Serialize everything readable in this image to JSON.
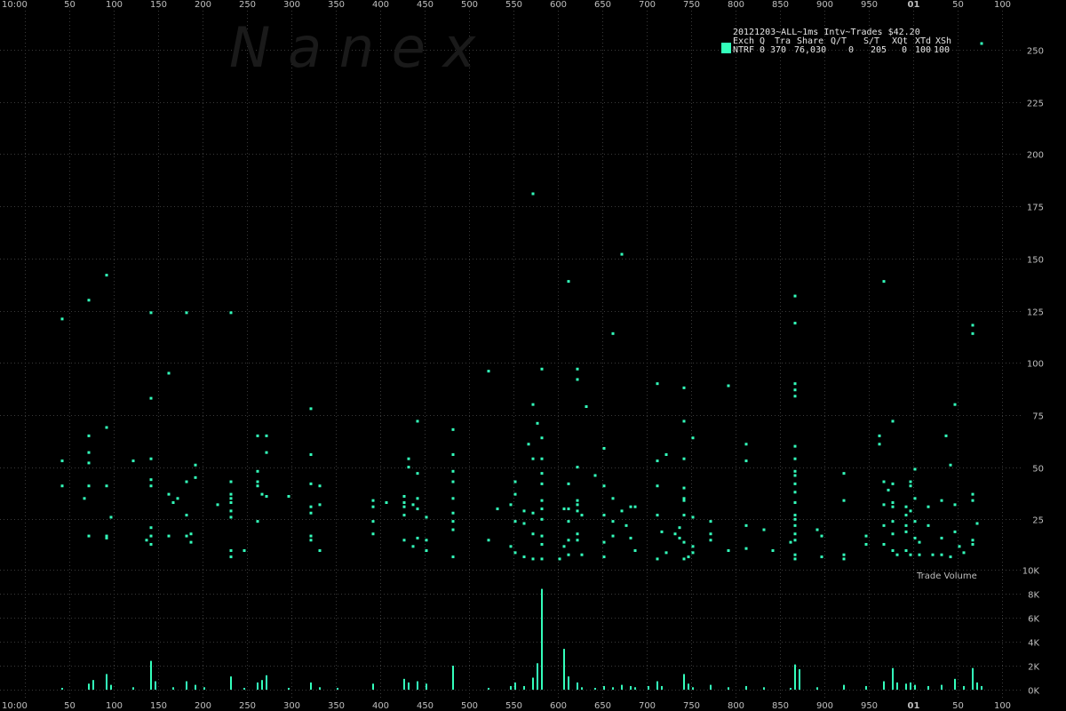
{
  "chart_data": [
    {
      "type": "scatter",
      "title": "20121203~ALL~1ms Intv~Trades $42.20",
      "watermark": "Nanex",
      "legend": {
        "placement": "top-right",
        "header": [
          "Exch",
          "Q",
          "Tra",
          "Share",
          "Q/T",
          "S/T",
          "XQt",
          "XTd",
          "XSh"
        ],
        "rows": [
          {
            "name": "NTRF",
            "values": [
              "0",
              "370",
              "76,030",
              "0",
              "205",
              "0",
              "100",
              "100"
            ],
            "color": "#33ffbb"
          }
        ]
      },
      "x_ticks": [
        "10:00",
        "50",
        "100",
        "150",
        "200",
        "250",
        "300",
        "350",
        "400",
        "450",
        "500",
        "550",
        "600",
        "650",
        "700",
        "750",
        "800",
        "850",
        "900",
        "950",
        "01",
        "50",
        "100"
      ],
      "xlim": [
        0,
        1100
      ],
      "y_ticks": [
        "25",
        "50",
        "75",
        "100",
        "125",
        "150",
        "175",
        "200",
        "225",
        "250"
      ],
      "ylim": [
        0,
        260
      ],
      "grid": true,
      "color": "#33ffbb",
      "points": [
        [
          42,
          121
        ],
        [
          42,
          53
        ],
        [
          42,
          41
        ],
        [
          72,
          130
        ],
        [
          92,
          142
        ],
        [
          72,
          65
        ],
        [
          72,
          57
        ],
        [
          72,
          52
        ],
        [
          72,
          41
        ],
        [
          92,
          69
        ],
        [
          92,
          41
        ],
        [
          67,
          35
        ],
        [
          97,
          26
        ],
        [
          72,
          17
        ],
        [
          92,
          17
        ],
        [
          92,
          16
        ],
        [
          142,
          124
        ],
        [
          182,
          124
        ],
        [
          232,
          124
        ],
        [
          142,
          83
        ],
        [
          162,
          95
        ],
        [
          122,
          53
        ],
        [
          142,
          54
        ],
        [
          142,
          44
        ],
        [
          142,
          41
        ],
        [
          137,
          15
        ],
        [
          142,
          21
        ],
        [
          142,
          17
        ],
        [
          142,
          13
        ],
        [
          162,
          17
        ],
        [
          182,
          17
        ],
        [
          182,
          27
        ],
        [
          182,
          43
        ],
        [
          187,
          18
        ],
        [
          187,
          14
        ],
        [
          192,
          51
        ],
        [
          192,
          45
        ],
        [
          162,
          37
        ],
        [
          167,
          33
        ],
        [
          172,
          35
        ],
        [
          217,
          32
        ],
        [
          232,
          43
        ],
        [
          232,
          37
        ],
        [
          232,
          35
        ],
        [
          232,
          33
        ],
        [
          232,
          29
        ],
        [
          232,
          26
        ],
        [
          232,
          10
        ],
        [
          232,
          7
        ],
        [
          247,
          10
        ],
        [
          262,
          65
        ],
        [
          262,
          48
        ],
        [
          262,
          43
        ],
        [
          262,
          41
        ],
        [
          262,
          24
        ],
        [
          267,
          37
        ],
        [
          272,
          65
        ],
        [
          272,
          57
        ],
        [
          272,
          36
        ],
        [
          297,
          36
        ],
        [
          322,
          78
        ],
        [
          322,
          56
        ],
        [
          322,
          42
        ],
        [
          322,
          31
        ],
        [
          322,
          28
        ],
        [
          322,
          17
        ],
        [
          322,
          15
        ],
        [
          332,
          41
        ],
        [
          332,
          32
        ],
        [
          332,
          10
        ],
        [
          392,
          34
        ],
        [
          392,
          31
        ],
        [
          392,
          24
        ],
        [
          392,
          18
        ],
        [
          407,
          33
        ],
        [
          427,
          36
        ],
        [
          427,
          33
        ],
        [
          427,
          31
        ],
        [
          427,
          27
        ],
        [
          427,
          15
        ],
        [
          432,
          54
        ],
        [
          432,
          50
        ],
        [
          437,
          32
        ],
        [
          437,
          12
        ],
        [
          442,
          72
        ],
        [
          442,
          47
        ],
        [
          442,
          35
        ],
        [
          442,
          30
        ],
        [
          442,
          16
        ],
        [
          452,
          26
        ],
        [
          452,
          15
        ],
        [
          452,
          10
        ],
        [
          482,
          68
        ],
        [
          482,
          56
        ],
        [
          482,
          48
        ],
        [
          482,
          43
        ],
        [
          482,
          35
        ],
        [
          482,
          28
        ],
        [
          482,
          24
        ],
        [
          482,
          20
        ],
        [
          482,
          7
        ],
        [
          522,
          96
        ],
        [
          522,
          15
        ],
        [
          532,
          30
        ],
        [
          547,
          32
        ],
        [
          547,
          12
        ],
        [
          552,
          43
        ],
        [
          552,
          37
        ],
        [
          552,
          24
        ],
        [
          552,
          9
        ],
        [
          562,
          29
        ],
        [
          562,
          23
        ],
        [
          562,
          7
        ],
        [
          572,
          80
        ],
        [
          567,
          61
        ],
        [
          572,
          54
        ],
        [
          572,
          28
        ],
        [
          572,
          18
        ],
        [
          577,
          71
        ],
        [
          582,
          97
        ],
        [
          582,
          64
        ],
        [
          582,
          54
        ],
        [
          582,
          47
        ],
        [
          582,
          42
        ],
        [
          582,
          34
        ],
        [
          582,
          30
        ],
        [
          582,
          25
        ],
        [
          582,
          17
        ],
        [
          582,
          13
        ],
        [
          582,
          6
        ],
        [
          572,
          181
        ],
        [
          572,
          6
        ],
        [
          607,
          30
        ],
        [
          612,
          139
        ],
        [
          602,
          6
        ],
        [
          607,
          12
        ],
        [
          612,
          24
        ],
        [
          612,
          42
        ],
        [
          612,
          30
        ],
        [
          612,
          15
        ],
        [
          612,
          8
        ],
        [
          622,
          97
        ],
        [
          622,
          92
        ],
        [
          622,
          50
        ],
        [
          622,
          34
        ],
        [
          622,
          32
        ],
        [
          622,
          29
        ],
        [
          622,
          18
        ],
        [
          622,
          15
        ],
        [
          627,
          8
        ],
        [
          632,
          79
        ],
        [
          627,
          27
        ],
        [
          642,
          46
        ],
        [
          652,
          41
        ],
        [
          652,
          59
        ],
        [
          652,
          27
        ],
        [
          652,
          14
        ],
        [
          652,
          7
        ],
        [
          662,
          114
        ],
        [
          662,
          35
        ],
        [
          662,
          24
        ],
        [
          662,
          17
        ],
        [
          672,
          152
        ],
        [
          672,
          29
        ],
        [
          677,
          22
        ],
        [
          682,
          31
        ],
        [
          687,
          31
        ],
        [
          687,
          10
        ],
        [
          682,
          16
        ],
        [
          712,
          90
        ],
        [
          712,
          53
        ],
        [
          712,
          41
        ],
        [
          712,
          27
        ],
        [
          717,
          19
        ],
        [
          712,
          6
        ],
        [
          722,
          56
        ],
        [
          722,
          9
        ],
        [
          732,
          18
        ],
        [
          737,
          21
        ],
        [
          742,
          88
        ],
        [
          742,
          72
        ],
        [
          742,
          54
        ],
        [
          742,
          40
        ],
        [
          742,
          35
        ],
        [
          742,
          34
        ],
        [
          742,
          27
        ],
        [
          737,
          16
        ],
        [
          742,
          14
        ],
        [
          742,
          6
        ],
        [
          747,
          7
        ],
        [
          752,
          64
        ],
        [
          752,
          26
        ],
        [
          752,
          12
        ],
        [
          752,
          9
        ],
        [
          772,
          24
        ],
        [
          772,
          18
        ],
        [
          772,
          15
        ],
        [
          792,
          89
        ],
        [
          792,
          10
        ],
        [
          812,
          61
        ],
        [
          812,
          53
        ],
        [
          812,
          22
        ],
        [
          812,
          11
        ],
        [
          832,
          20
        ],
        [
          842,
          10
        ],
        [
          862,
          14
        ],
        [
          867,
          132
        ],
        [
          867,
          119
        ],
        [
          867,
          90
        ],
        [
          867,
          87
        ],
        [
          867,
          84
        ],
        [
          867,
          60
        ],
        [
          867,
          54
        ],
        [
          867,
          48
        ],
        [
          867,
          46
        ],
        [
          867,
          42
        ],
        [
          867,
          38
        ],
        [
          867,
          33
        ],
        [
          867,
          27
        ],
        [
          867,
          25
        ],
        [
          867,
          22
        ],
        [
          867,
          18
        ],
        [
          867,
          15
        ],
        [
          867,
          8
        ],
        [
          867,
          6
        ],
        [
          892,
          20
        ],
        [
          897,
          17
        ],
        [
          897,
          7
        ],
        [
          922,
          47
        ],
        [
          922,
          34
        ],
        [
          922,
          8
        ],
        [
          922,
          6
        ],
        [
          947,
          17
        ],
        [
          947,
          13
        ],
        [
          967,
          139
        ],
        [
          962,
          65
        ],
        [
          962,
          61
        ],
        [
          967,
          43
        ],
        [
          967,
          32
        ],
        [
          967,
          22
        ],
        [
          967,
          13
        ],
        [
          972,
          39
        ],
        [
          977,
          72
        ],
        [
          977,
          42
        ],
        [
          977,
          33
        ],
        [
          977,
          31
        ],
        [
          977,
          24
        ],
        [
          977,
          18
        ],
        [
          977,
          10
        ],
        [
          982,
          8
        ],
        [
          992,
          31
        ],
        [
          992,
          27
        ],
        [
          992,
          22
        ],
        [
          992,
          19
        ],
        [
          992,
          10
        ],
        [
          997,
          43
        ],
        [
          997,
          41
        ],
        [
          997,
          29
        ],
        [
          997,
          8
        ],
        [
          1002,
          49
        ],
        [
          1002,
          35
        ],
        [
          1002,
          24
        ],
        [
          1002,
          16
        ],
        [
          1007,
          14
        ],
        [
          1007,
          8
        ],
        [
          1017,
          31
        ],
        [
          1017,
          22
        ],
        [
          1022,
          8
        ],
        [
          1032,
          16
        ],
        [
          1032,
          8
        ],
        [
          1037,
          65
        ],
        [
          1032,
          34
        ],
        [
          1042,
          51
        ],
        [
          1047,
          80
        ],
        [
          1047,
          32
        ],
        [
          1047,
          19
        ],
        [
          1042,
          7
        ],
        [
          1052,
          12
        ],
        [
          1057,
          9
        ],
        [
          1067,
          118
        ],
        [
          1067,
          114
        ],
        [
          1067,
          37
        ],
        [
          1067,
          34
        ],
        [
          1072,
          23
        ],
        [
          1067,
          15
        ],
        [
          1067,
          13
        ],
        [
          1077,
          253
        ]
      ]
    },
    {
      "type": "bar",
      "title": "Trade Volume",
      "y_ticks": [
        "0K",
        "2K",
        "4K",
        "6K",
        "8K",
        "10K"
      ],
      "ylim": [
        0,
        10000
      ],
      "grid": true,
      "color": "#33ffbb",
      "bars": [
        [
          42,
          150
        ],
        [
          72,
          500
        ],
        [
          77,
          800
        ],
        [
          92,
          1300
        ],
        [
          97,
          400
        ],
        [
          122,
          200
        ],
        [
          142,
          2400
        ],
        [
          147,
          700
        ],
        [
          167,
          200
        ],
        [
          182,
          700
        ],
        [
          192,
          400
        ],
        [
          202,
          200
        ],
        [
          232,
          1100
        ],
        [
          247,
          150
        ],
        [
          262,
          600
        ],
        [
          267,
          800
        ],
        [
          272,
          1200
        ],
        [
          297,
          150
        ],
        [
          322,
          600
        ],
        [
          332,
          200
        ],
        [
          352,
          150
        ],
        [
          392,
          500
        ],
        [
          427,
          900
        ],
        [
          432,
          600
        ],
        [
          442,
          700
        ],
        [
          452,
          500
        ],
        [
          482,
          2000
        ],
        [
          522,
          150
        ],
        [
          547,
          300
        ],
        [
          552,
          600
        ],
        [
          562,
          300
        ],
        [
          572,
          1000
        ],
        [
          577,
          2200
        ],
        [
          582,
          8400
        ],
        [
          607,
          3400
        ],
        [
          612,
          1100
        ],
        [
          622,
          600
        ],
        [
          627,
          200
        ],
        [
          642,
          150
        ],
        [
          652,
          300
        ],
        [
          662,
          200
        ],
        [
          672,
          400
        ],
        [
          682,
          300
        ],
        [
          687,
          200
        ],
        [
          702,
          300
        ],
        [
          712,
          700
        ],
        [
          717,
          300
        ],
        [
          742,
          1300
        ],
        [
          747,
          500
        ],
        [
          752,
          200
        ],
        [
          772,
          400
        ],
        [
          792,
          200
        ],
        [
          812,
          300
        ],
        [
          832,
          200
        ],
        [
          862,
          150
        ],
        [
          867,
          2100
        ],
        [
          872,
          1700
        ],
        [
          892,
          200
        ],
        [
          922,
          400
        ],
        [
          947,
          300
        ],
        [
          967,
          700
        ],
        [
          977,
          1800
        ],
        [
          982,
          600
        ],
        [
          992,
          500
        ],
        [
          997,
          600
        ],
        [
          1002,
          400
        ],
        [
          1017,
          300
        ],
        [
          1032,
          400
        ],
        [
          1047,
          900
        ],
        [
          1057,
          300
        ],
        [
          1067,
          1800
        ],
        [
          1072,
          600
        ],
        [
          1077,
          300
        ]
      ]
    }
  ]
}
